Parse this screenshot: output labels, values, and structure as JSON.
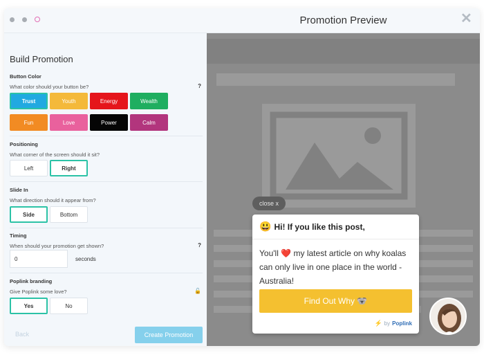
{
  "window": {
    "title": "Promotion Preview"
  },
  "panel": {
    "title": "Build Promotion",
    "button_color": {
      "label": "Button Color",
      "question": "What color should your button be?",
      "help": "?",
      "options": [
        {
          "label": "Trust",
          "color": "#21a9e1",
          "selected": true
        },
        {
          "label": "Youth",
          "color": "#f4b93a",
          "selected": false
        },
        {
          "label": "Energy",
          "color": "#e5151b",
          "selected": false
        },
        {
          "label": "Wealth",
          "color": "#1fae60",
          "selected": false
        },
        {
          "label": "Fun",
          "color": "#f28b23",
          "selected": false
        },
        {
          "label": "Love",
          "color": "#e9619d",
          "selected": false
        },
        {
          "label": "Power",
          "color": "#050505",
          "selected": false
        },
        {
          "label": "Calm",
          "color": "#b2357d",
          "selected": false
        }
      ]
    },
    "positioning": {
      "label": "Positioning",
      "question": "What corner of the screen should it sit?",
      "options": [
        "Left",
        "Right"
      ],
      "selected": "Right"
    },
    "slide_in": {
      "label": "Slide In",
      "question": "What direction should it appear from?",
      "options": [
        "Side",
        "Bottom"
      ],
      "selected": "Side"
    },
    "timing": {
      "label": "Timing",
      "question": "When should your promotion get shown?",
      "help": "?",
      "value": "0",
      "unit": "seconds"
    },
    "branding": {
      "label": "Poplink branding",
      "question": "Give Poplink some love?",
      "options": [
        "Yes",
        "No"
      ],
      "selected": "Yes"
    },
    "back_label": "Back",
    "create_label": "Create Promotion"
  },
  "preview": {
    "close_label": "close x",
    "headline": "Hi! If you like this post,",
    "body_before": "You'll",
    "body_after": "my latest article on why koalas can only live in one place in the world - Australia!",
    "cta_label": "Find Out Why 🐨",
    "by_label": "by",
    "brand": "Poplink",
    "cta_color": "#f4c030"
  }
}
